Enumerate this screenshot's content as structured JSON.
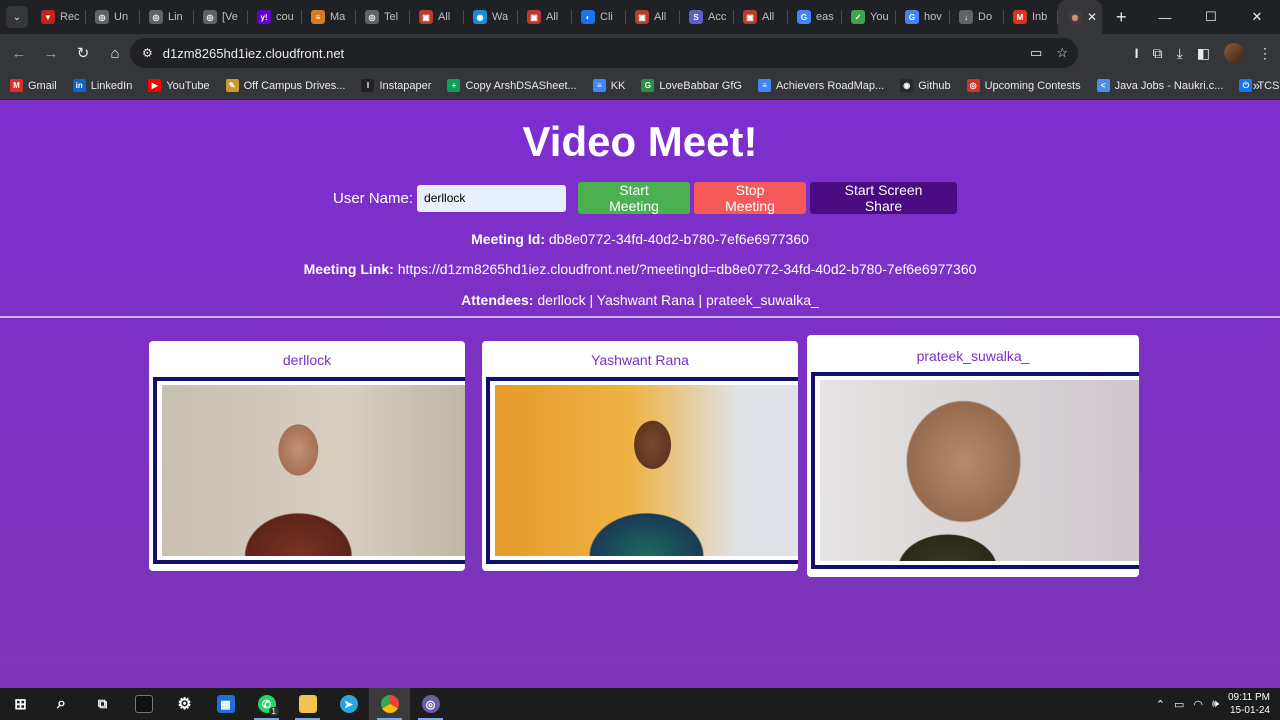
{
  "browser": {
    "tabs": [
      {
        "label": "Rec",
        "color": "#c5221f",
        "glyph": "▼"
      },
      {
        "label": "Un",
        "color": "#5f6368",
        "glyph": "◎"
      },
      {
        "label": "Lin",
        "color": "#5f6368",
        "glyph": "◎"
      },
      {
        "label": "[Ve",
        "color": "#5f6368",
        "glyph": "◎"
      },
      {
        "label": "cou",
        "color": "#6001d2",
        "glyph": "y!"
      },
      {
        "label": "Ma",
        "color": "#d97a2b",
        "glyph": "≡"
      },
      {
        "label": "Tel",
        "color": "#5f6368",
        "glyph": "◎"
      },
      {
        "label": "All",
        "color": "#b93b2f",
        "glyph": "▣"
      },
      {
        "label": "Wa",
        "color": "#1a8bd6",
        "glyph": "◉"
      },
      {
        "label": "All",
        "color": "#b93b2f",
        "glyph": "▣"
      },
      {
        "label": "Cli",
        "color": "#1a73e8",
        "glyph": "◐"
      },
      {
        "label": "All",
        "color": "#b93b2f",
        "glyph": "▣"
      },
      {
        "label": "Acc",
        "color": "#5b5fc7",
        "glyph": "S"
      },
      {
        "label": "All",
        "color": "#b93b2f",
        "glyph": "▣"
      },
      {
        "label": "eas",
        "color": "#4285f4",
        "glyph": "G"
      },
      {
        "label": "You",
        "color": "#3fa34d",
        "glyph": "✓"
      },
      {
        "label": "hov",
        "color": "#4285f4",
        "glyph": "G"
      },
      {
        "label": "Do",
        "color": "#5f6368",
        "glyph": "↓"
      },
      {
        "label": "Inb",
        "color": "#d93025",
        "glyph": "M"
      }
    ],
    "active_tab_glyph": "◉",
    "tab_close": "✕",
    "new_tab": "+",
    "window_controls": {
      "minimize": "—",
      "maximize": "☐",
      "close": "✕"
    },
    "url": "d1zm8265hd1iez.cloudfront.net",
    "bookmarks": [
      {
        "label": "Gmail",
        "color": "#d93025",
        "glyph": "M"
      },
      {
        "label": "LinkedIn",
        "color": "#0a66c2",
        "glyph": "in"
      },
      {
        "label": "YouTube",
        "color": "#ff0000",
        "glyph": "▶"
      },
      {
        "label": "Off Campus Drives...",
        "color": "#c89b2c",
        "glyph": "✎"
      },
      {
        "label": "Instapaper",
        "color": "#222222",
        "glyph": "I"
      },
      {
        "label": "Copy ArshDSASheet...",
        "color": "#0f9d58",
        "glyph": "+"
      },
      {
        "label": "KK",
        "color": "#4285f4",
        "glyph": "≡"
      },
      {
        "label": "LoveBabbar GfG",
        "color": "#2f8d46",
        "glyph": "G"
      },
      {
        "label": "Achievers RoadMap...",
        "color": "#4285f4",
        "glyph": "≡"
      },
      {
        "label": "Github",
        "color": "#24292f",
        "glyph": "◉"
      },
      {
        "label": "Upcoming Contests",
        "color": "#d93025",
        "glyph": "◎"
      },
      {
        "label": "Java Jobs - Naukri.c...",
        "color": "#4a90e2",
        "glyph": "<"
      },
      {
        "label": "TCS Jobs",
        "color": "#1a73e8",
        "glyph": "⏻"
      }
    ],
    "bookmarks_more": "»"
  },
  "page": {
    "title": "Video Meet!",
    "user_name_label": "User Name:",
    "user_name_value": "derllock",
    "start_button": "Start Meeting",
    "stop_button": "Stop Meeting",
    "share_button": "Start Screen Share",
    "meeting_id_label": "Meeting Id:",
    "meeting_id_value": "db8e0772-34fd-40d2-b780-7ef6e6977360",
    "meeting_link_label": "Meeting Link:",
    "meeting_link_value": "https://d1zm8265hd1iez.cloudfront.net/?meetingId=db8e0772-34fd-40d2-b780-7ef6e6977360",
    "attendees_label": "Attendees:",
    "attendees_value": "derllock | Yashwant Rana | prateek_suwalka_",
    "participants": [
      {
        "name": "derllock"
      },
      {
        "name": "Yashwant Rana"
      },
      {
        "name": "prateek_suwalka_"
      }
    ]
  },
  "taskbar": {
    "whatsapp_badge": "1",
    "time": "09:11 PM",
    "date": "15-01-24"
  }
}
